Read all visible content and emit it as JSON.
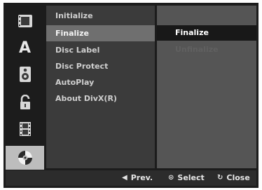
{
  "icons": [
    {
      "name": "movie-icon"
    },
    {
      "name": "language-icon",
      "glyph": "A"
    },
    {
      "name": "audio-speaker-icon"
    },
    {
      "name": "lock-icon"
    },
    {
      "name": "film-strip-icon"
    },
    {
      "name": "disc-icon"
    }
  ],
  "menu": {
    "items": [
      {
        "label": "Initialize",
        "selected": false
      },
      {
        "label": "Finalize",
        "selected": true
      },
      {
        "label": "Disc Label",
        "selected": false
      },
      {
        "label": "Disc Protect",
        "selected": false
      },
      {
        "label": "AutoPlay",
        "selected": false
      },
      {
        "label": "About DivX(R)",
        "selected": false
      }
    ]
  },
  "submenu": {
    "items": [
      {
        "label": "Finalize",
        "selected": true
      },
      {
        "label": "Unfinalize",
        "selected": false,
        "disabled": true
      }
    ]
  },
  "hints": {
    "prev": {
      "glyph": "◀",
      "label": "Prev."
    },
    "select": {
      "glyph": "⊙",
      "label": "Select"
    },
    "close": {
      "glyph": "↻",
      "label": "Close"
    }
  }
}
